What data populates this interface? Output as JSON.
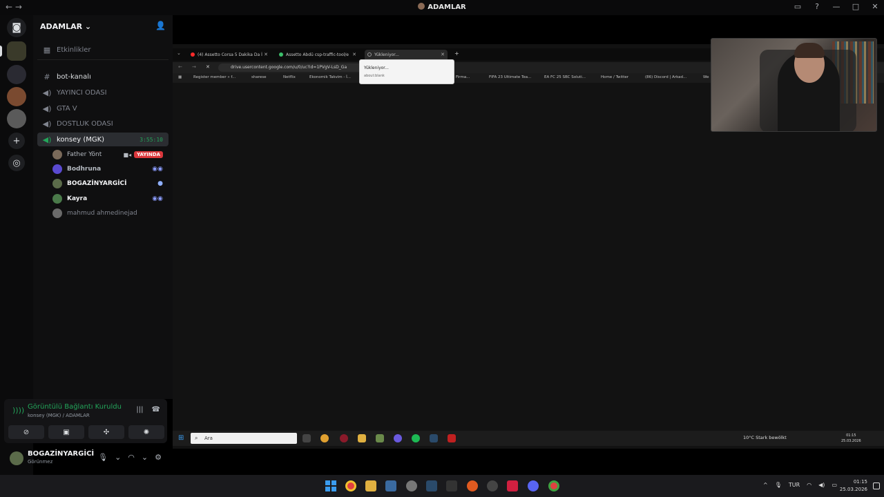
{
  "titlebar": {
    "title": "ADAMLAR"
  },
  "server": {
    "name": "ADAMLAR ⌄"
  },
  "channels": {
    "events": "Etkinlikler",
    "items": [
      {
        "name": "bot-kanalı"
      },
      {
        "name": "YAYINCI ODASI"
      },
      {
        "name": "GTA V"
      },
      {
        "name": "DOSTLUK ODASI"
      },
      {
        "name": "konsey (MGK)",
        "timer": "3:55:10"
      }
    ]
  },
  "members": [
    {
      "name": "Father Yönt",
      "badge": "YAYINDA"
    },
    {
      "name": "Bodhruna"
    },
    {
      "name": "BOGAZİNYARGİCİ"
    },
    {
      "name": "Kayra"
    },
    {
      "name": "mahmud ahmedinejad"
    }
  ],
  "voice": {
    "status": "Görüntülü Bağlantı Kuruldu",
    "location": "konsey (MGK) / ADAMLAR"
  },
  "user": {
    "name": "BOGAZİNYARGİCİ",
    "status": "Görünmez"
  },
  "browser": {
    "tabs": [
      {
        "label": "(4) Assetto Corsa 5 Dakika Da İ",
        "color": "#ff2a2a"
      },
      {
        "label": "Assetto Abdü csp-traffic-tool/e",
        "color": "#3bbf6a"
      },
      {
        "label": "Yükleniyor...",
        "color": "#9a9a9a"
      }
    ],
    "url": "drive.usercontent.google.com/u/0/uc?id=1PVgV-LsD_Ga",
    "tooltip_title": "Yükleniyor...",
    "tooltip_sub": "about:blank",
    "bookmarks": [
      "Register member » f...",
      "sharese",
      "Netflix",
      "Ekonomik Takvim - İ...",
      "Firma...",
      "FIFA 23 Ultimate Tea...",
      "EA FC 25 SBC Soluti...",
      "Home / Twitter",
      "(86) Discord | Arkad...",
      "We"
    ]
  },
  "inner_taskbar": {
    "search_placeholder": "Ara",
    "weather": "10°C  Stark bewölkt",
    "time": "01:15",
    "date": "25.03.2026"
  },
  "taskbar": {
    "lang": "TUR",
    "time": "01:15",
    "date": "25.03.2026"
  },
  "colors": {
    "accent_green": "#23a55a",
    "live_red": "#da373c",
    "bg": "#000000"
  }
}
